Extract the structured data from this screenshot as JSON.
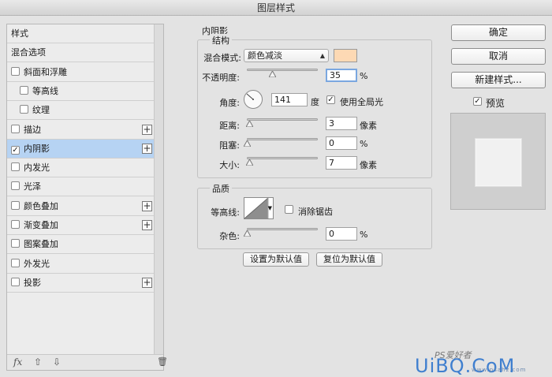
{
  "window": {
    "title": "图层样式"
  },
  "style_list": {
    "items": [
      {
        "label": "样式",
        "checkbox": false,
        "plus": false,
        "checked": false
      },
      {
        "label": "混合选项",
        "checkbox": false,
        "plus": false,
        "checked": false
      },
      {
        "label": "斜面和浮雕",
        "checkbox": true,
        "plus": false,
        "checked": false
      },
      {
        "label": "等高线",
        "checkbox": true,
        "plus": false,
        "checked": false,
        "sub": true
      },
      {
        "label": "纹理",
        "checkbox": true,
        "plus": false,
        "checked": false,
        "sub": true
      },
      {
        "label": "描边",
        "checkbox": true,
        "plus": true,
        "checked": false
      },
      {
        "label": "内阴影",
        "checkbox": true,
        "plus": true,
        "checked": true,
        "selected": true
      },
      {
        "label": "内发光",
        "checkbox": true,
        "plus": false,
        "checked": false
      },
      {
        "label": "光泽",
        "checkbox": true,
        "plus": false,
        "checked": false
      },
      {
        "label": "颜色叠加",
        "checkbox": true,
        "plus": true,
        "checked": false
      },
      {
        "label": "渐变叠加",
        "checkbox": true,
        "plus": true,
        "checked": false
      },
      {
        "label": "图案叠加",
        "checkbox": true,
        "plus": false,
        "checked": false
      },
      {
        "label": "外发光",
        "checkbox": true,
        "plus": false,
        "checked": false
      },
      {
        "label": "投影",
        "checkbox": true,
        "plus": true,
        "checked": false
      }
    ],
    "footer": {
      "fx": "fx",
      "up": "⇧",
      "down": "⇩",
      "trash": "🗑"
    }
  },
  "inner_shadow": {
    "section_title": "内阴影",
    "structure": {
      "group_title": "结构",
      "blend_mode_label": "混合模式:",
      "blend_mode_value": "颜色减淡",
      "shadow_color": "#fdd9b4",
      "opacity_label": "不透明度:",
      "opacity_value": "35",
      "opacity_unit": "%",
      "opacity_level": 0.35,
      "angle_label": "角度:",
      "angle_value": "141",
      "angle_unit": "度",
      "global_light_label": "使用全局光",
      "global_light_checked": true,
      "distance_label": "距离:",
      "distance_value": "3",
      "distance_unit": "像素",
      "distance_level": 0.03,
      "choke_label": "阻塞:",
      "choke_value": "0",
      "choke_unit": "%",
      "choke_level": 0,
      "size_label": "大小:",
      "size_value": "7",
      "size_unit": "像素",
      "size_level": 0.03
    },
    "quality": {
      "group_title": "品质",
      "contour_label": "等高线:",
      "antialias_label": "消除锯齿",
      "antialias_checked": false,
      "noise_label": "杂色:",
      "noise_value": "0",
      "noise_unit": "%",
      "noise_level": 0
    },
    "buttons": {
      "make_default": "设置为默认值",
      "reset_default": "复位为默认值"
    }
  },
  "right_panel": {
    "ok": "确定",
    "cancel": "取消",
    "new_style": "新建样式...",
    "preview_label": "预览",
    "preview_checked": true
  },
  "watermark": {
    "ps_text": "PS爱好者",
    "main": "UiBQ.CoM",
    "sub": "www.psahz.com"
  }
}
